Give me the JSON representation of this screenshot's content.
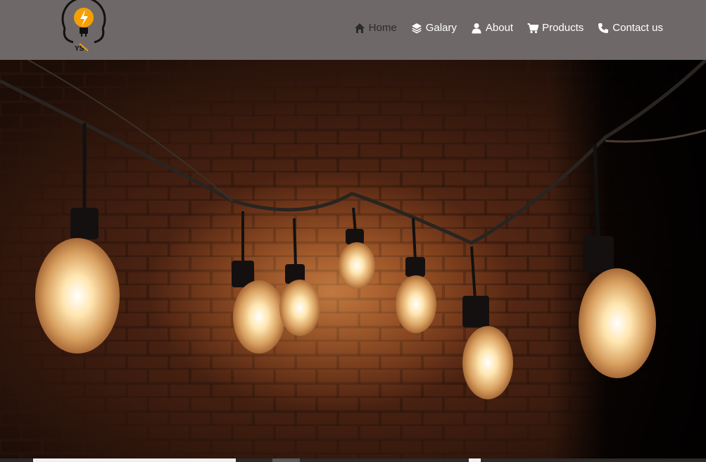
{
  "logo": {
    "text": "YS",
    "accent_color": "#f5a000"
  },
  "nav": {
    "items": [
      {
        "label": "Home",
        "icon": "home-icon",
        "active": true
      },
      {
        "label": "Galary",
        "icon": "layers-icon",
        "active": false
      },
      {
        "label": "About",
        "icon": "user-icon",
        "active": false
      },
      {
        "label": "Products",
        "icon": "cart-icon",
        "active": false
      },
      {
        "label": "Contact us",
        "icon": "phone-icon",
        "active": false
      }
    ]
  },
  "colors": {
    "header_bg": "#6f6869",
    "nav_text": "#ffffff",
    "nav_active": "#2b2b2b",
    "bulb_glow": "#ffd98a"
  }
}
